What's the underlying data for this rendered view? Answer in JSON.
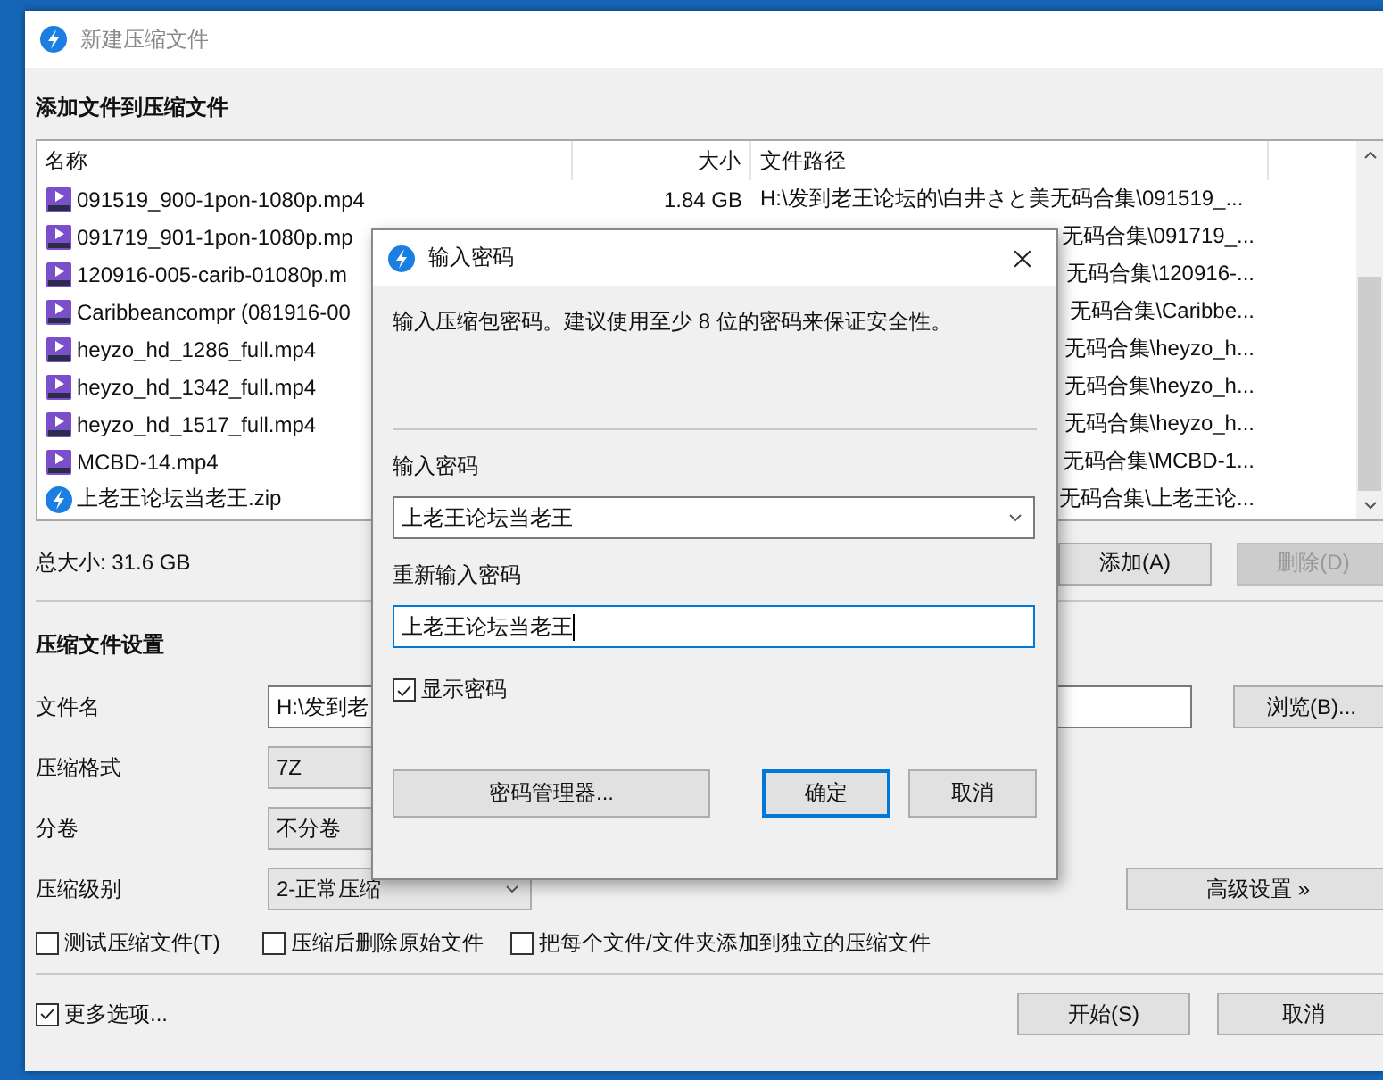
{
  "main_window": {
    "title": "新建压缩文件",
    "heading": "添加文件到压缩文件",
    "file_list": {
      "columns": [
        "名称",
        "大小",
        "文件路径"
      ],
      "rows": [
        {
          "kind": "video",
          "name": "091519_900-1pon-1080p.mp4",
          "size": "1.84 GB",
          "path": "H:\\发到老王论坛的\\白井さと美无码合集\\091519_...",
          "covered": false
        },
        {
          "kind": "video",
          "name": "091719_901-1pon-1080p.mp",
          "path": "无码合集\\091719_...",
          "covered": true
        },
        {
          "kind": "video",
          "name": "120916-005-carib-01080p.m",
          "path": "无码合集\\120916-...",
          "covered": true
        },
        {
          "kind": "video",
          "name": "Caribbeancompr (081916-00",
          "path": "无码合集\\Caribbe...",
          "covered": true
        },
        {
          "kind": "video",
          "name": "heyzo_hd_1286_full.mp4",
          "path": "无码合集\\heyzo_h...",
          "covered": true
        },
        {
          "kind": "video",
          "name": "heyzo_hd_1342_full.mp4",
          "path": "无码合集\\heyzo_h...",
          "covered": true
        },
        {
          "kind": "video",
          "name": "heyzo_hd_1517_full.mp4",
          "path": "无码合集\\heyzo_h...",
          "covered": true
        },
        {
          "kind": "video",
          "name": "MCBD-14.mp4",
          "path": "无码合集\\MCBD-1...",
          "covered": true
        },
        {
          "kind": "archive",
          "name": "上老王论坛当老王.zip",
          "path": "无码合集\\上老王论...",
          "covered": true
        }
      ]
    },
    "total_size": "总大小: 31.6 GB",
    "list_buttons": [
      {
        "label": "添加(A)",
        "disabled": false
      },
      {
        "label": "删除(D)",
        "disabled": true
      }
    ],
    "settings_heading": "压缩文件设置",
    "settings": [
      {
        "label": "文件名",
        "kind": "text",
        "value": "H:\\发到老",
        "button": "浏览(B)..."
      },
      {
        "label": "压缩格式",
        "kind": "select",
        "value": "7Z"
      },
      {
        "label": "分卷",
        "kind": "select",
        "value": "不分卷"
      },
      {
        "label": "压缩级别",
        "kind": "select",
        "value": "2-正常压缩",
        "button": "高级设置 »"
      }
    ],
    "options": [
      {
        "label": "测试压缩文件(T)",
        "checked": false
      },
      {
        "label": "压缩后删除原始文件",
        "checked": false
      },
      {
        "label": "把每个文件/文件夹添加到独立的压缩文件",
        "checked": false
      }
    ],
    "more_options": {
      "label": "更多选项...",
      "checked": true
    },
    "buttons": [
      {
        "label": "开始(S)"
      },
      {
        "label": "取消"
      }
    ]
  },
  "password_dialog": {
    "title": "输入密码",
    "description": "输入压缩包密码。建议使用至少 8 位的密码来保证安全性。",
    "password_label": "输入密码",
    "password_value": "上老王论坛当老王",
    "confirm_label": "重新输入密码",
    "confirm_value": "上老王论坛当老王",
    "show_password": {
      "label": "显示密码",
      "checked": true
    },
    "manager_button": "密码管理器...",
    "buttons": [
      {
        "label": "确定",
        "default": true
      },
      {
        "label": "取消",
        "default": false
      }
    ]
  }
}
